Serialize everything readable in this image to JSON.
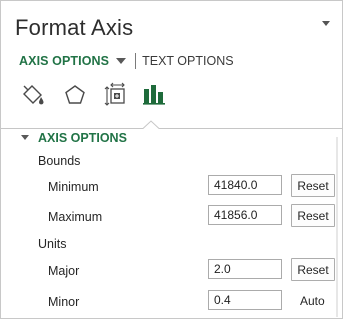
{
  "pane": {
    "title": "Format Axis",
    "tabs": {
      "axis_options": "AXIS OPTIONS",
      "text_options": "TEXT OPTIONS"
    },
    "icons": [
      "fill-line-icon",
      "effects-pentagon-icon",
      "size-properties-icon",
      "axis-options-bar-chart-icon"
    ]
  },
  "section": {
    "header": "AXIS OPTIONS",
    "bounds_label": "Bounds",
    "minimum": {
      "label": "Minimum",
      "value": "41840.0",
      "button": "Reset"
    },
    "maximum": {
      "label": "Maximum",
      "value": "41856.0",
      "button": "Reset"
    },
    "units_label": "Units",
    "major": {
      "label": "Major",
      "value": "2.0",
      "button": "Reset"
    },
    "minor": {
      "label": "Minor",
      "value": "0.4",
      "status": "Auto"
    }
  },
  "colors": {
    "accent_green": "#217346",
    "text": "#262626",
    "border": "#ababab"
  }
}
